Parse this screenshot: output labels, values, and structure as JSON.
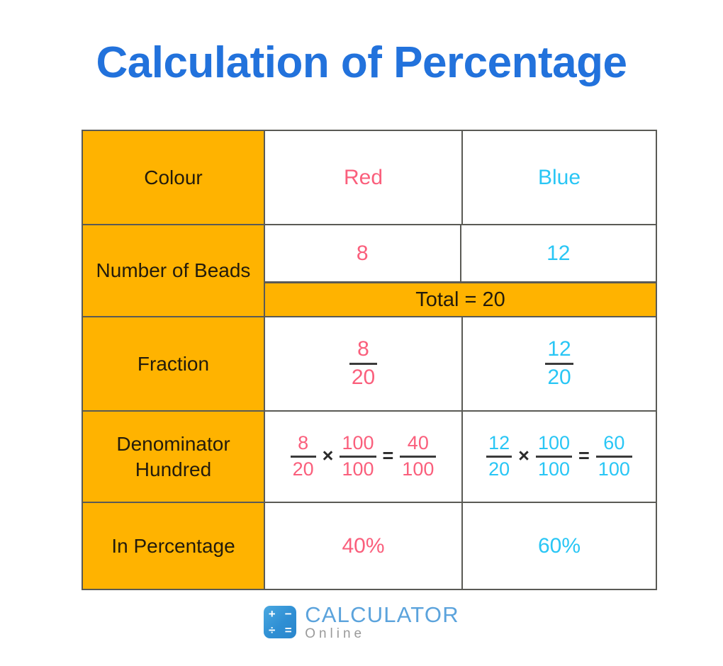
{
  "title": "Calculation of Percentage",
  "colors": {
    "title_blue": "#2272DC",
    "header_orange": "#FFB300",
    "red": "#FA5F7C",
    "blue": "#29C6F5",
    "border": "#5A5A55",
    "label_text": "#231B0C"
  },
  "table": {
    "rows": [
      {
        "label": "Colour",
        "red": "Red",
        "blue": "Blue"
      },
      {
        "label": "Number of Beads",
        "red": "8",
        "blue": "12",
        "total": "Total = 20"
      },
      {
        "label": "Fraction",
        "red": {
          "num": "8",
          "den": "20"
        },
        "blue": {
          "num": "12",
          "den": "20"
        }
      },
      {
        "label": "Denominator Hundred",
        "red": {
          "f1": {
            "num": "8",
            "den": "20"
          },
          "op1": "×",
          "f2": {
            "num": "100",
            "den": "100"
          },
          "op2": "=",
          "f3": {
            "num": "40",
            "den": "100"
          }
        },
        "blue": {
          "f1": {
            "num": "12",
            "den": "20"
          },
          "op1": "×",
          "f2": {
            "num": "100",
            "den": "100"
          },
          "op2": "=",
          "f3": {
            "num": "60",
            "den": "100"
          }
        }
      },
      {
        "label": "In Percentage",
        "red": "40%",
        "blue": "60%"
      }
    ]
  },
  "logo": {
    "main": "CALCULATOR",
    "sub": "Online",
    "symbols": [
      "+",
      "−",
      "÷",
      "="
    ]
  }
}
